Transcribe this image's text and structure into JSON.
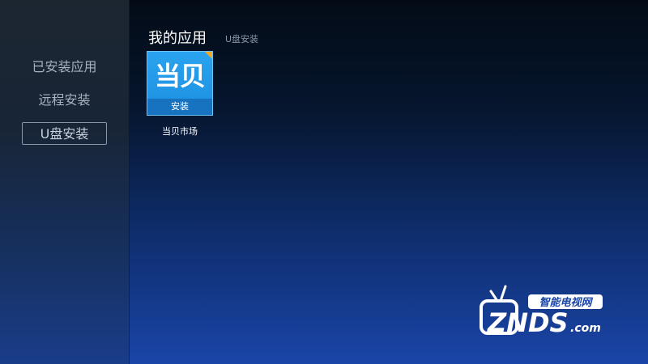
{
  "sidebar": {
    "items": [
      {
        "label": "已安装应用",
        "selected": false
      },
      {
        "label": "远程安装",
        "selected": false
      },
      {
        "label": "U盘安装",
        "selected": true
      }
    ]
  },
  "header": {
    "title": "我的应用",
    "subtitle": "U盘安装"
  },
  "apps": [
    {
      "icon_text": "当贝",
      "icon_bar_label": "安装",
      "name": "当贝市场"
    }
  ],
  "watermark": {
    "top_text": "智能电视网",
    "brand": "ZNDS",
    "domain": ".com"
  },
  "colors": {
    "app_icon_blue": "#1c8fe0",
    "corner_orange": "#f5a623",
    "selected_border": "#8b96a8"
  }
}
